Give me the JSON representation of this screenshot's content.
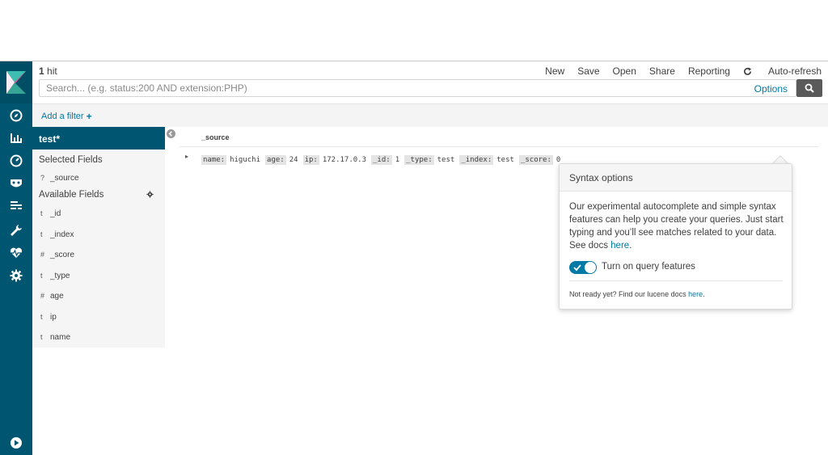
{
  "header": {
    "hits_count": "1",
    "hits_label": "hit",
    "menu": [
      "New",
      "Save",
      "Open",
      "Share",
      "Reporting",
      "Auto-refresh"
    ]
  },
  "search": {
    "placeholder": "Search... (e.g. status:200 AND extension:PHP)",
    "value": "",
    "options_label": "Options"
  },
  "filter_bar": {
    "add_filter_label": "Add a filter",
    "add_filter_icon": "+"
  },
  "sidebar": {
    "index_pattern": "test*",
    "selected_title": "Selected Fields",
    "selected_fields": [
      {
        "type": "?",
        "name": "_source"
      }
    ],
    "available_title": "Available Fields",
    "available_fields": [
      {
        "type": "t",
        "name": "_id"
      },
      {
        "type": "t",
        "name": "_index"
      },
      {
        "type": "#",
        "name": "_score"
      },
      {
        "type": "t",
        "name": "_type"
      },
      {
        "type": "#",
        "name": "age"
      },
      {
        "type": "t",
        "name": "ip"
      },
      {
        "type": "t",
        "name": "name"
      }
    ]
  },
  "table": {
    "column_header": "_source",
    "row_expand_icon": "▸",
    "row": [
      {
        "key": "name:",
        "value": "higuchi"
      },
      {
        "key": "age:",
        "value": "24"
      },
      {
        "key": "ip:",
        "value": "172.17.0.3"
      },
      {
        "key": "_id:",
        "value": "1"
      },
      {
        "key": "_type:",
        "value": "test"
      },
      {
        "key": "_index:",
        "value": "test"
      },
      {
        "key": "_score:",
        "value": "0"
      }
    ]
  },
  "popover": {
    "title": "Syntax options",
    "body_text": "Our experimental autocomplete and simple syntax features can help you create your queries. Just start typing and you’ll see matches related to your data. See docs ",
    "body_link": "here",
    "body_end": ".",
    "toggle_label": "Turn on query features",
    "toggle_on": true,
    "footer_text": "Not ready yet? Find our lucene docs ",
    "footer_link": "here",
    "footer_end": "."
  },
  "colors": {
    "nav_bg": "#005571",
    "accent": "#0079a5",
    "search_button": "#5a5a5a"
  },
  "icons": {
    "nav": [
      "kibana-logo-icon",
      "discover-compass-icon",
      "visualize-chart-icon",
      "dashboard-gauge-icon",
      "timelion-mask-icon",
      "dev-tools-icon",
      "wrench-icon",
      "monitoring-heart-icon",
      "settings-gear-icon",
      "collapse-play-icon"
    ],
    "search_button": "search-icon",
    "refresh": "refresh-icon"
  }
}
